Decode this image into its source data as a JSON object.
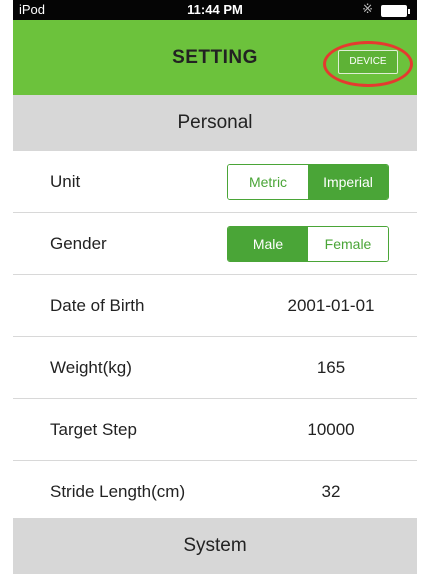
{
  "status_bar": {
    "carrier": "iPod",
    "time": "11:44 PM",
    "bluetooth_icon": "bluetooth-icon",
    "battery_icon": "battery-icon"
  },
  "nav": {
    "title": "SETTING",
    "device_button": "DEVICE"
  },
  "sections": {
    "personal": "Personal",
    "system": "System"
  },
  "settings": {
    "unit": {
      "label": "Unit",
      "options": [
        "Metric",
        "Imperial"
      ],
      "selected": "Imperial"
    },
    "gender": {
      "label": "Gender",
      "options": [
        "Male",
        "Female"
      ],
      "selected": "Male"
    },
    "date_of_birth": {
      "label": "Date of Birth",
      "value": "2001-01-01"
    },
    "weight": {
      "label": "Weight(kg)",
      "value": "165"
    },
    "target_step": {
      "label": "Target Step",
      "value": "10000"
    },
    "stride_length": {
      "label": "Stride Length(cm)",
      "value": "32"
    }
  },
  "colors": {
    "accent": "#6cc23c",
    "segment": "#4aa537",
    "highlight_ring": "#e53a2f",
    "section_bg": "#d7d7d7"
  }
}
